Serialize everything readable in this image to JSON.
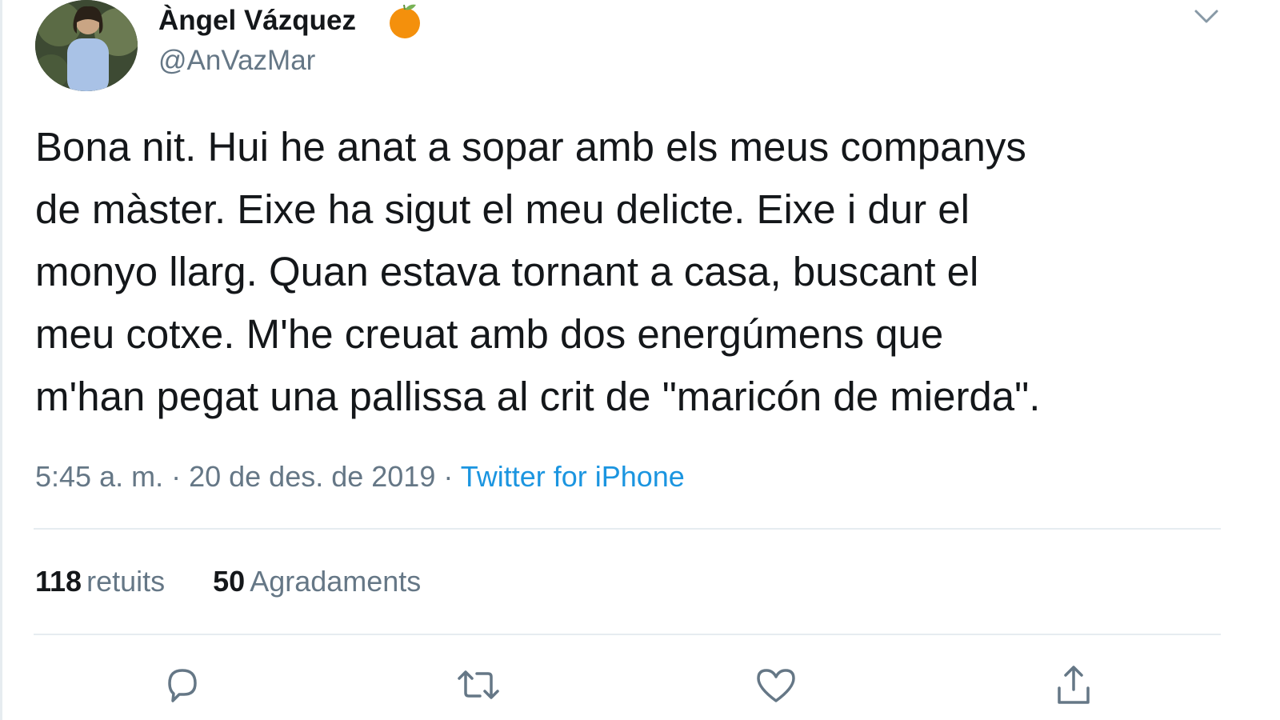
{
  "tweet": {
    "author": {
      "name": "Àngel Vázquez",
      "handle": "@AnVazMar",
      "avatar_icon": "user-avatar-photo",
      "badge_icon": "orange-emoji-icon"
    },
    "text_lines": [
      "Bona nit. Hui he anat a sopar amb els meus companys",
      "de màster. Eixe ha sigut el meu delicte. Eixe i dur el",
      "monyo llarg. Quan estava tornant a casa, buscant el",
      "meu cotxe. M'he creuat amb dos energúmens que",
      "m'han pegat una pallissa al crit de \"maricón de mierda\"."
    ],
    "meta": {
      "timestamp": "5:45 a. m. · 20 de des. de 2019",
      "separator": " · ",
      "source": "Twitter for iPhone"
    },
    "stats": {
      "retweets_count": "118",
      "retweets_label": "retuits",
      "likes_count": "50",
      "likes_label": "Agradaments"
    },
    "actions": [
      "reply-icon",
      "retweet-icon",
      "like-icon",
      "share-icon"
    ],
    "colors": {
      "text": "#14171a",
      "secondary": "#657786",
      "link": "#1b95e0",
      "divider": "#e6ecf0",
      "orange": "#f4900c"
    }
  }
}
